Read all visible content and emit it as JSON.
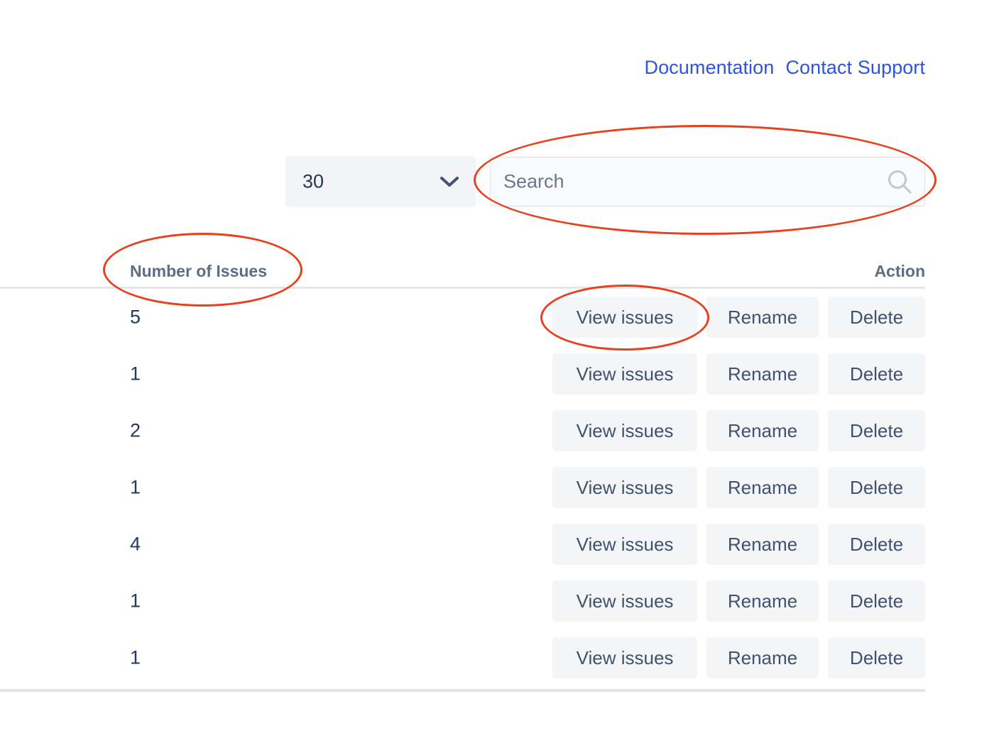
{
  "top_nav": {
    "links": [
      {
        "label": "Documentation"
      },
      {
        "label": "Contact Support"
      }
    ]
  },
  "controls": {
    "page_size_select": {
      "value": "30",
      "icon": "chevron-down-icon"
    },
    "search": {
      "value": "",
      "placeholder": "Search",
      "icon": "search-icon"
    }
  },
  "table": {
    "columns": [
      {
        "key": "issues",
        "label": "Number of Issues"
      },
      {
        "key": "action",
        "label": "Action"
      }
    ],
    "action_labels": {
      "view": "View issues",
      "rename": "Rename",
      "delete": "Delete"
    },
    "rows": [
      {
        "issues": "5"
      },
      {
        "issues": "1"
      },
      {
        "issues": "2"
      },
      {
        "issues": "1"
      },
      {
        "issues": "4"
      },
      {
        "issues": "1"
      },
      {
        "issues": "1"
      }
    ]
  },
  "annotations": {
    "color": "#e8401c",
    "highlights": [
      {
        "target": "search-input"
      },
      {
        "target": "column-header-number-of-issues"
      },
      {
        "target": "view-issues-button-row-1"
      }
    ]
  },
  "theme": {
    "link_color": "#2c56d9",
    "text_color": "#253858",
    "muted_text_color": "#5e6c84",
    "button_bg": "#f4f5f7",
    "button_text": "#42526e",
    "divider_color": "#e4e6ea"
  }
}
